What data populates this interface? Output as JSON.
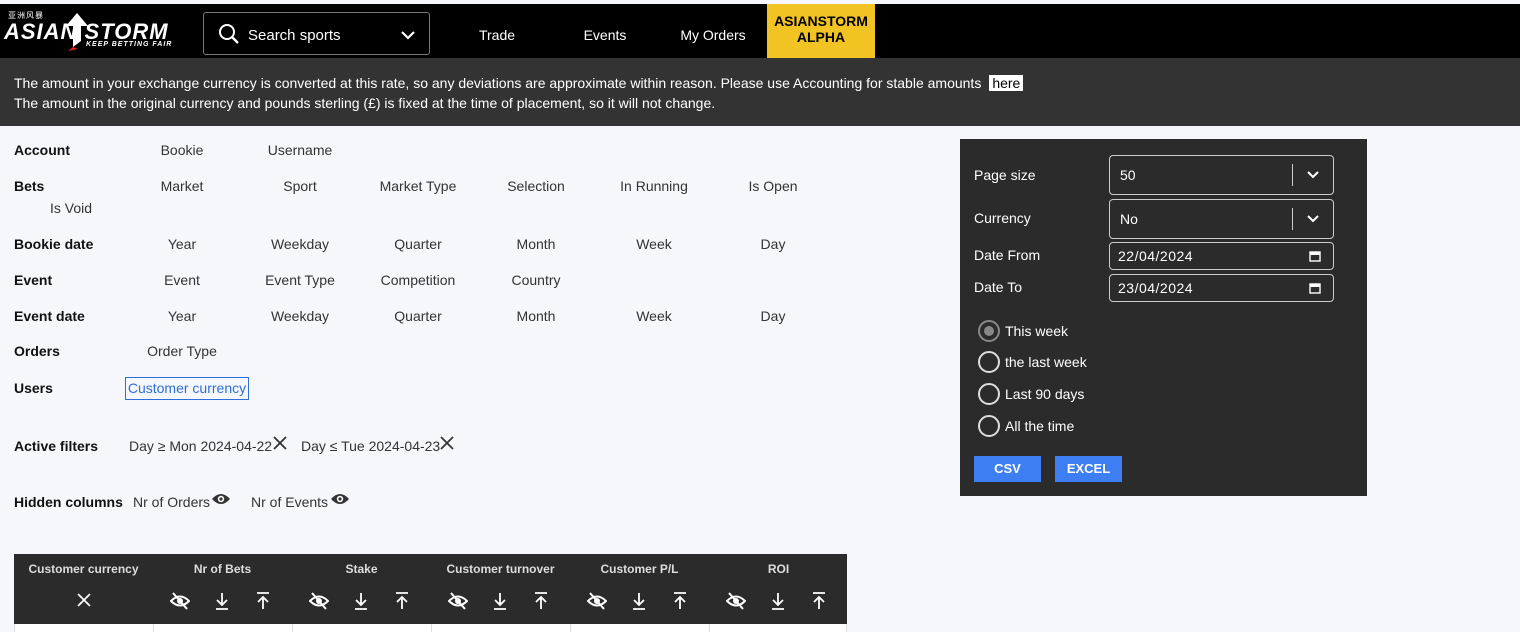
{
  "header": {
    "logo_cn": "亚洲风暴",
    "logo_brand": "ASIAN STORM",
    "logo_tagline": "KEEP BETTING FAIR",
    "search_placeholder": "Search sports",
    "nav": [
      "Trade",
      "Events",
      "My Orders"
    ],
    "alpha_line1": "ASIANSTORM",
    "alpha_line2": "ALPHA",
    "alpha_color": "#f2c423"
  },
  "banner": {
    "line1": "The amount in your exchange currency is converted at this rate, so any deviations are approximate within reason.  Please use Accounting for stable amounts",
    "here": "here",
    "line2": "The amount in the original currency and pounds sterling (£) is fixed at the time of placement, so it will not change."
  },
  "groups": {
    "account": {
      "label": "Account",
      "options": [
        "Bookie",
        "Username"
      ]
    },
    "bets": {
      "label": "Bets",
      "options": [
        "Market",
        "Sport",
        "Market Type",
        "Selection",
        "In Running",
        "Is Open",
        "Is Void"
      ]
    },
    "bookie_date": {
      "label": "Bookie date",
      "options": [
        "Year",
        "Weekday",
        "Quarter",
        "Month",
        "Week",
        "Day"
      ]
    },
    "event": {
      "label": "Event",
      "options": [
        "Event",
        "Event Type",
        "Competition",
        "Country"
      ]
    },
    "event_date": {
      "label": "Event date",
      "options": [
        "Year",
        "Weekday",
        "Quarter",
        "Month",
        "Week",
        "Day"
      ]
    },
    "orders": {
      "label": "Orders",
      "options": [
        "Order Type"
      ]
    },
    "users": {
      "label": "Users",
      "options": [
        "Customer currency"
      ]
    }
  },
  "active_filters": {
    "label": "Active filters",
    "items": [
      "Day ≥ Mon 2024-04-22",
      "Day ≤ Tue 2024-04-23"
    ]
  },
  "hidden_columns": {
    "label": "Hidden columns",
    "items": [
      "Nr of Orders",
      "Nr of Events"
    ]
  },
  "panel": {
    "page_size_label": "Page size",
    "page_size_value": "50",
    "currency_label": "Currency",
    "currency_value": "No",
    "date_from_label": "Date From",
    "date_from_value": "22/04/2024",
    "date_to_label": "Date To",
    "date_to_value": "23/04/2024",
    "ranges": [
      "This week",
      "the last week",
      "Last 90 days",
      "All the time"
    ],
    "selected_range": "This week",
    "csv": "CSV",
    "excel": "EXCEL",
    "accent": "#3d7ff2"
  },
  "table": {
    "columns": [
      "Customer currency",
      "Nr of Bets",
      "Stake",
      "Customer turnover",
      "Customer P/L",
      "ROI"
    ]
  }
}
